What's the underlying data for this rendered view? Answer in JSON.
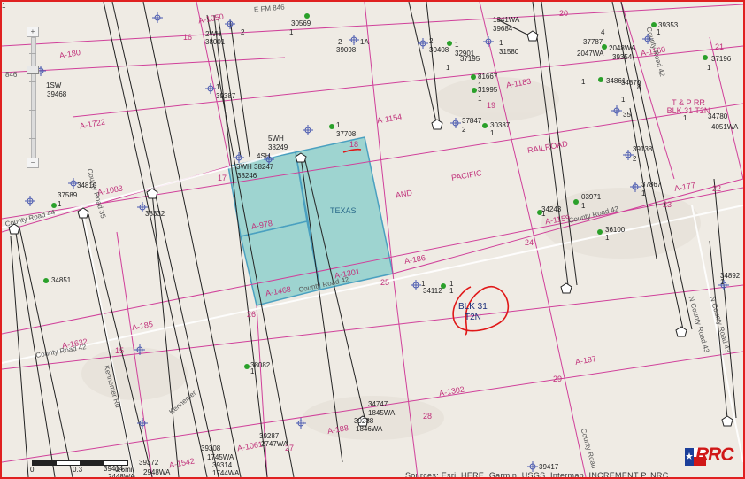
{
  "map": {
    "colors": {
      "background": "#efebe4",
      "survey_line": "#d0409a",
      "road_line": "#ffffff",
      "highlight_fill": "#8fd0cc",
      "highlight_stroke": "#4aa0c0",
      "well_line": "#222222",
      "well_green": "#2aa02a",
      "well_blue": "#4a5ab0",
      "annotation_red": "#e01818",
      "frame_red": "#e02020"
    },
    "survey_labels": [
      "A-1050",
      "A-180",
      "A-1722",
      "A-1083",
      "A-978",
      "A-1468",
      "A-1301",
      "A-186",
      "A-185",
      "A-1632",
      "A-1154",
      "A-1183",
      "A-1160",
      "A-1159",
      "A-177",
      "A-187",
      "A-188",
      "A-1302",
      "A-1061",
      "A-1542"
    ],
    "section_numbers": [
      "16",
      "17",
      "18",
      "19",
      "20",
      "21",
      "22",
      "23",
      "24",
      "25",
      "26",
      "28",
      "29",
      "27",
      "15"
    ],
    "road_labels": [
      "E FM 846",
      "846",
      "County Road 44",
      "County Road 35",
      "County Road 42",
      "County Road 42",
      "County Road 42",
      "County Road 42",
      "N County Road 43",
      "N County Road 43",
      "Kennemer Rd",
      "Kennemer",
      "County Road"
    ],
    "railroad_labels": [
      "TEXAS",
      "AND",
      "PACIFIC",
      "RAILROAD",
      "T & P RR BLK 31 T2N"
    ],
    "well_labels": [
      "2WH",
      "38001",
      "2",
      "30569",
      "1",
      "2",
      "39098",
      "1A",
      "1SW",
      "39468",
      "1",
      "39387",
      "1",
      "37708",
      "5WH",
      "38249",
      "4SH",
      "3WH 38247",
      "38246",
      "2",
      "30408",
      "1",
      "32901",
      "1341WA",
      "39684",
      "1",
      "31580",
      "4",
      "37787",
      "2048WA",
      "2047WA",
      "39354",
      "39353",
      "1",
      "37196",
      "1",
      "37195",
      "1",
      "81667",
      "1",
      "31995",
      "1",
      "34861",
      "1",
      "34870",
      "8",
      "1",
      "35",
      "37847",
      "2",
      "30387",
      "1",
      "34780",
      "1",
      "4051WA",
      "39138",
      "2",
      "37867",
      "1",
      "37589",
      "1",
      "34810",
      "38332",
      "34243",
      "1",
      "03971",
      "1",
      "36100",
      "1",
      "34851",
      "1",
      "1",
      "34112",
      "1",
      "34892",
      "1",
      "38082",
      "1",
      "34747",
      "1845WA",
      "39288",
      "1846WA",
      "39287",
      "2747WA",
      "39308",
      "1745WA",
      "39314",
      "1744WA",
      "39372",
      "2948WA",
      "39414",
      "2448WA",
      "39417",
      "1"
    ],
    "annotation": [
      "BLK 31",
      "T2N"
    ]
  },
  "controls": {
    "zoom_in": "+",
    "zoom_out": "−",
    "scale_labels": [
      "0",
      "0.3",
      "0.6mi"
    ],
    "attribution": "Sources: Esri, HERE, Garmin, USGS, Intermap, INCREMENT P, NRC...",
    "logo_text": "RRC"
  }
}
